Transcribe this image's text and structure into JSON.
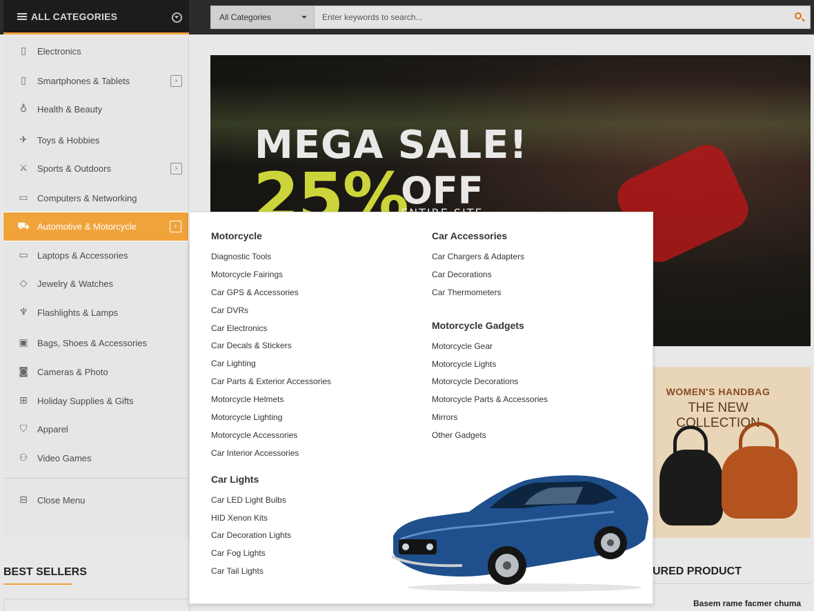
{
  "header": {
    "all_categories_label": "ALL CATEGORIES",
    "search_select_value": "All Categories",
    "search_placeholder": "Enter keywords to search..."
  },
  "sidebar": {
    "items": [
      {
        "label": "Electronics",
        "icon": "tablet-icon",
        "has_submenu": false
      },
      {
        "label": "Smartphones & Tablets",
        "icon": "smartphone-icon",
        "has_submenu": true
      },
      {
        "label": "Health & Beauty",
        "icon": "bottle-icon",
        "has_submenu": false
      },
      {
        "label": "Toys & Hobbies",
        "icon": "toy-icon",
        "has_submenu": false
      },
      {
        "label": "Sports & Outdoors",
        "icon": "sports-icon",
        "has_submenu": true
      },
      {
        "label": "Computers & Networking",
        "icon": "monitor-icon",
        "has_submenu": false
      },
      {
        "label": "Automotive & Motorcycle",
        "icon": "car-icon",
        "has_submenu": true,
        "active": true
      },
      {
        "label": "Laptops & Accessories",
        "icon": "laptop-icon",
        "has_submenu": false
      },
      {
        "label": "Jewelry & Watches",
        "icon": "diamond-icon",
        "has_submenu": false
      },
      {
        "label": "Flashlights & Lamps",
        "icon": "flashlight-icon",
        "has_submenu": false
      },
      {
        "label": "Bags, Shoes & Accessories",
        "icon": "bag-icon",
        "has_submenu": false
      },
      {
        "label": "Cameras & Photo",
        "icon": "camera-icon",
        "has_submenu": false
      },
      {
        "label": "Holiday Supplies & Gifts",
        "icon": "gift-icon",
        "has_submenu": false
      },
      {
        "label": "Apparel",
        "icon": "shirt-icon",
        "has_submenu": false
      },
      {
        "label": "Video Games",
        "icon": "gamepad-icon",
        "has_submenu": false
      }
    ],
    "close_label": "Close Menu"
  },
  "banner": {
    "headline": "MEGA SALE!",
    "percent": "25%",
    "off": "OFF",
    "subline": "ENTIRE SITE"
  },
  "promo": {
    "title": "WOMEN'S HANDBAG",
    "subtitle": "THE NEW COLLECTION"
  },
  "sections": {
    "best_sellers": "BEST SELLERS",
    "featured_partial": "URED PRODUCT",
    "product_name": "Basem rame facmer chuma"
  },
  "mega_menu": {
    "left": [
      {
        "title": "Motorcycle",
        "links": [
          "Diagnostic Tools",
          "Motorcycle Fairings",
          "Car GPS & Accessories",
          "Car DVRs",
          "Car Electronics",
          "Car Decals & Stickers",
          "Car Lighting",
          "Car Parts & Exterior Accessories",
          "Motorcycle Helmets",
          "Motorcycle Lighting",
          "Motorcycle Accessories",
          "Car Interior Accessories"
        ]
      },
      {
        "title": "Car Lights",
        "links": [
          "Car LED Light Bulbs",
          "HID Xenon Kits",
          "Car Decoration Lights",
          "Car Fog Lights",
          "Car Tail Lights"
        ]
      }
    ],
    "right": [
      {
        "title": "Car Accessories",
        "links": [
          "Car Chargers & Adapters",
          "Car Decorations",
          "Car Thermometers"
        ]
      },
      {
        "title": "Motorcycle Gadgets",
        "links": [
          "Motorcycle Gear",
          "Motorcycle Lights",
          "Motorcycle Decorations",
          "Motorcycle Parts & Accessories",
          "Mirrors",
          "Other Gadgets"
        ]
      }
    ]
  },
  "colors": {
    "accent": "#f0a33b",
    "topbar": "#2b2b2b",
    "car_blue": "#1f4f8c"
  }
}
